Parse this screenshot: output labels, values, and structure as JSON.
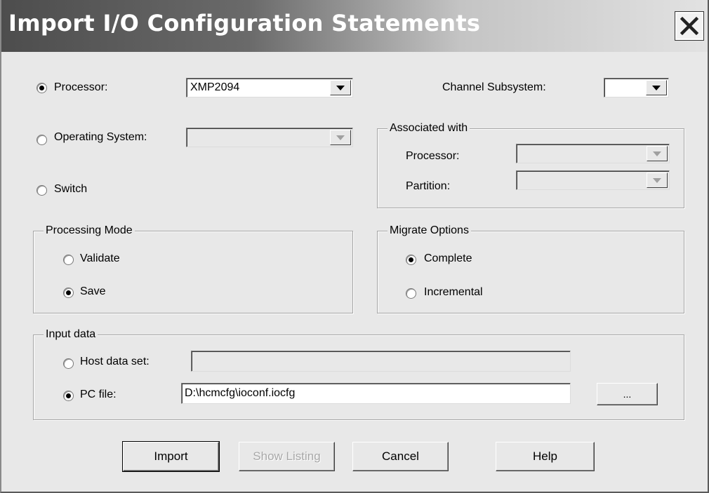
{
  "dialog": {
    "title": "Import I/O Configuration Statements"
  },
  "target": {
    "processor_label": "Processor:",
    "processor_value": "XMP2094",
    "processor_selected": true,
    "os_label": "Operating System:",
    "os_value": "",
    "os_selected": false,
    "switch_label": "Switch",
    "switch_selected": false
  },
  "channel_subsystem": {
    "label": "Channel Subsystem:",
    "value": ""
  },
  "associated_with": {
    "legend": "Associated with",
    "processor_label": "Processor:",
    "processor_value": "",
    "partition_label": "Partition:",
    "partition_value": ""
  },
  "processing_mode": {
    "legend": "Processing Mode",
    "options": [
      {
        "label": "Validate",
        "selected": false
      },
      {
        "label": "Save",
        "selected": true
      }
    ]
  },
  "migrate_options": {
    "legend": "Migrate Options",
    "options": [
      {
        "label": "Complete",
        "selected": true
      },
      {
        "label": "Incremental",
        "selected": false
      }
    ]
  },
  "input_data": {
    "legend": "Input data",
    "host_label": "Host data set:",
    "host_value": "",
    "host_selected": false,
    "pc_label": "PC file:",
    "pc_value": "D:\\hcmcfg\\ioconf.iocfg",
    "pc_selected": true,
    "browse_label": "..."
  },
  "buttons": {
    "import": "Import",
    "show_listing": "Show Listing",
    "cancel": "Cancel",
    "help": "Help"
  },
  "icons": {
    "close": "close-icon",
    "dropdown": "chevron-down-icon"
  }
}
